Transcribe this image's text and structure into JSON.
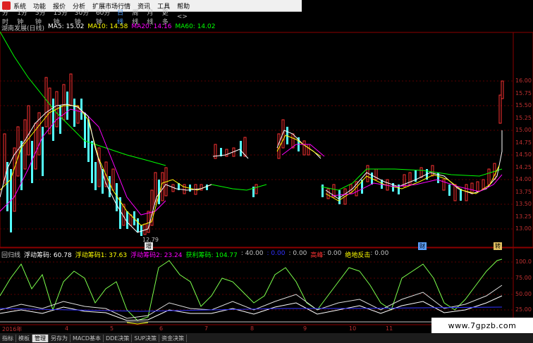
{
  "menu": {
    "items": [
      "系统",
      "功能",
      "报价",
      "分析",
      "扩展市场行情",
      "资讯",
      "工具",
      "帮助"
    ]
  },
  "periods": {
    "items": [
      "分时",
      "1分钟",
      "5分钟",
      "15分钟",
      "30分钟",
      "60分钟",
      "日线",
      "周线",
      "月线",
      "更多"
    ],
    "active": "日线",
    "more_arrow": "<>"
  },
  "title": {
    "stock": "湖南发展(日线)",
    "ma5": "MA5: 15.02",
    "ma10": "MA10: 14.58",
    "ma20": "MA20: 14.16",
    "ma60": "MA60: 14.02"
  },
  "indicator": {
    "name": "回归线",
    "f1": "浮动筹码: 60.78",
    "f2": "浮动筹码1: 37.63",
    "f3": "浮动筹码2: 23.24",
    "profit": "获利筹码: 104.77",
    "v40": ": 40.00",
    "v0a": ": 0.00",
    "v0b": ": 0.00",
    "gao": "高峰",
    "v0c": ": 0.00",
    "jue": "绝地反击",
    "v0d": ": 0.00"
  },
  "price_axis": [
    "16.00",
    "15.75",
    "15.50",
    "15.25",
    "15.00",
    "14.75",
    "14.50",
    "14.25",
    "14.00",
    "13.75",
    "13.50",
    "13.25",
    "13.00"
  ],
  "ind_axis": [
    "100.0",
    "75.00",
    "50.00",
    "25.00"
  ],
  "low_label": "12.79",
  "markers": {
    "cai": "财",
    "ying": "增",
    "zhuan": "转"
  },
  "dates": [
    "2016年",
    "4",
    "5",
    "6",
    "7",
    "8",
    "9",
    "10",
    "11"
  ],
  "bottom_tabs": [
    "指标",
    "模板",
    "管理",
    "另存为",
    "MACD基本",
    "DDE决策",
    "SUP决策",
    "资金决策"
  ],
  "bottom_active": "管理",
  "watermark": "www.7gpzb.com",
  "colors": {
    "up": "#ff3232",
    "down": "#54ffff",
    "ma5": "#ffffff",
    "ma10": "#ffff00",
    "ma20": "#ff00ff",
    "ma60": "#00ff00"
  }
}
